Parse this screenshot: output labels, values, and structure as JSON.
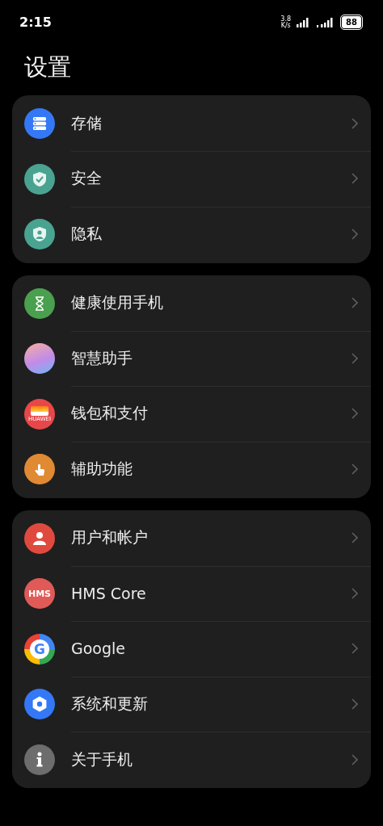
{
  "status_bar": {
    "time": "2:15",
    "speed_value": "3.8",
    "speed_unit": "K/s",
    "battery": "88"
  },
  "title": "设置",
  "groups": [
    {
      "items": [
        {
          "label": "存储",
          "kind": "storage",
          "color": "#3478f6"
        },
        {
          "label": "安全",
          "kind": "security",
          "color": "#4aa391"
        },
        {
          "label": "隐私",
          "kind": "privacy",
          "color": "#4aa391"
        }
      ]
    },
    {
      "items": [
        {
          "label": "健康使用手机",
          "kind": "health",
          "color": "#4aa04e"
        },
        {
          "label": "智慧助手",
          "kind": "assistant",
          "color": "#c28be8"
        },
        {
          "label": "钱包和支付",
          "kind": "wallet",
          "color": "#e8474a",
          "badge_text": "HUAWEI"
        },
        {
          "label": "辅助功能",
          "kind": "accessibility",
          "color": "#e08a34"
        }
      ]
    },
    {
      "items": [
        {
          "label": "用户和帐户",
          "kind": "account",
          "color": "#e04a3e"
        },
        {
          "label": "HMS Core",
          "kind": "hms",
          "color": "#e05a58",
          "badge_text": "HMS"
        },
        {
          "label": "Google",
          "kind": "google",
          "badge_text": "G"
        },
        {
          "label": "系统和更新",
          "kind": "system",
          "color": "#3478f6"
        },
        {
          "label": "关于手机",
          "kind": "about",
          "color": "#6d6d6d"
        }
      ]
    }
  ]
}
